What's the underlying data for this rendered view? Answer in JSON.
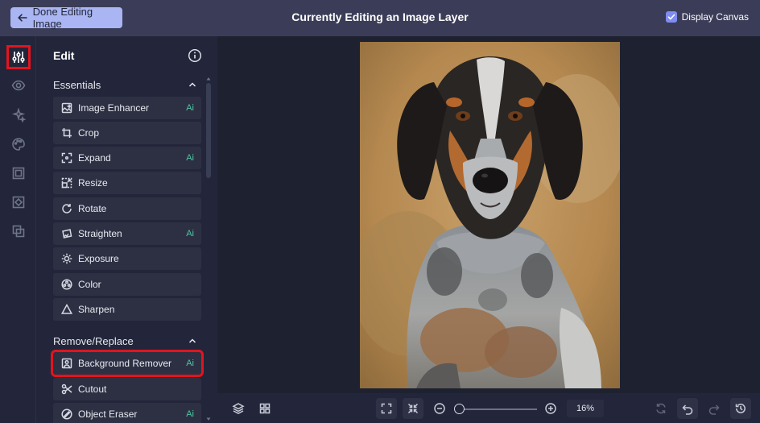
{
  "header": {
    "back_label": "Done Editing Image",
    "title": "Currently Editing an Image Layer",
    "display_canvas_label": "Display Canvas",
    "display_canvas_checked": true
  },
  "rail": {
    "items": [
      {
        "name": "adjustments-icon",
        "active": true
      },
      {
        "name": "eye-icon",
        "active": false
      },
      {
        "name": "sparkle-effects-icon",
        "active": false
      },
      {
        "name": "palette-icon",
        "active": false
      },
      {
        "name": "frame-icon",
        "active": false
      },
      {
        "name": "texture-icon",
        "active": false
      },
      {
        "name": "overlay-icon",
        "active": false
      }
    ]
  },
  "panel": {
    "title": "Edit",
    "sections": [
      {
        "title": "Essentials",
        "tools": [
          {
            "label": "Image Enhancer",
            "icon": "image-enhancer-icon",
            "ai": "Ai"
          },
          {
            "label": "Crop",
            "icon": "crop-icon"
          },
          {
            "label": "Expand",
            "icon": "expand-icon",
            "ai": "Ai"
          },
          {
            "label": "Resize",
            "icon": "resize-icon"
          },
          {
            "label": "Rotate",
            "icon": "rotate-icon"
          },
          {
            "label": "Straighten",
            "icon": "straighten-icon",
            "ai": "Ai"
          },
          {
            "label": "Exposure",
            "icon": "exposure-icon"
          },
          {
            "label": "Color",
            "icon": "color-icon"
          },
          {
            "label": "Sharpen",
            "icon": "sharpen-icon"
          }
        ]
      },
      {
        "title": "Remove/Replace",
        "tools": [
          {
            "label": "Background Remover",
            "icon": "background-remover-icon",
            "ai": "Ai",
            "highlighted": true
          },
          {
            "label": "Cutout",
            "icon": "cutout-icon"
          },
          {
            "label": "Object Eraser",
            "icon": "object-eraser-icon",
            "ai": "Ai"
          }
        ]
      }
    ]
  },
  "toolbar": {
    "zoom_level": "16%"
  },
  "colors": {
    "accent": "#a9b6f3",
    "highlight": "#e2141e",
    "ai_badge": "#4ec7a2"
  }
}
